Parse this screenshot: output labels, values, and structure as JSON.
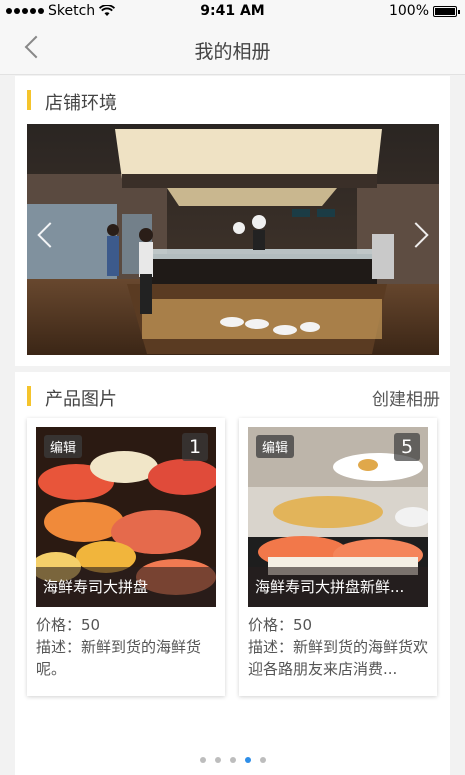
{
  "status_bar": {
    "carrier": "Sketch",
    "time": "9:41 AM",
    "battery": "100%"
  },
  "nav": {
    "title": "我的相册"
  },
  "store_section": {
    "title": "店铺环境"
  },
  "product_section": {
    "title": "产品图片",
    "action": "创建相册",
    "cards": [
      {
        "edit_label": "编辑",
        "count": "1",
        "name": "海鲜寿司大拼盘",
        "price": "价格：50",
        "desc": "描述：新鲜到货的海鲜货呢。"
      },
      {
        "edit_label": "编辑",
        "count": "5",
        "name": "海鲜寿司大拼盘新鲜...",
        "price": "价格：50",
        "desc": "描述：新鲜到货的海鲜货欢迎各路朋友来店消费..."
      }
    ]
  },
  "pager": {
    "total": 5,
    "active": 4
  },
  "colors": {
    "accent": "#f5c42c",
    "pager_active": "#2e8ee8"
  }
}
